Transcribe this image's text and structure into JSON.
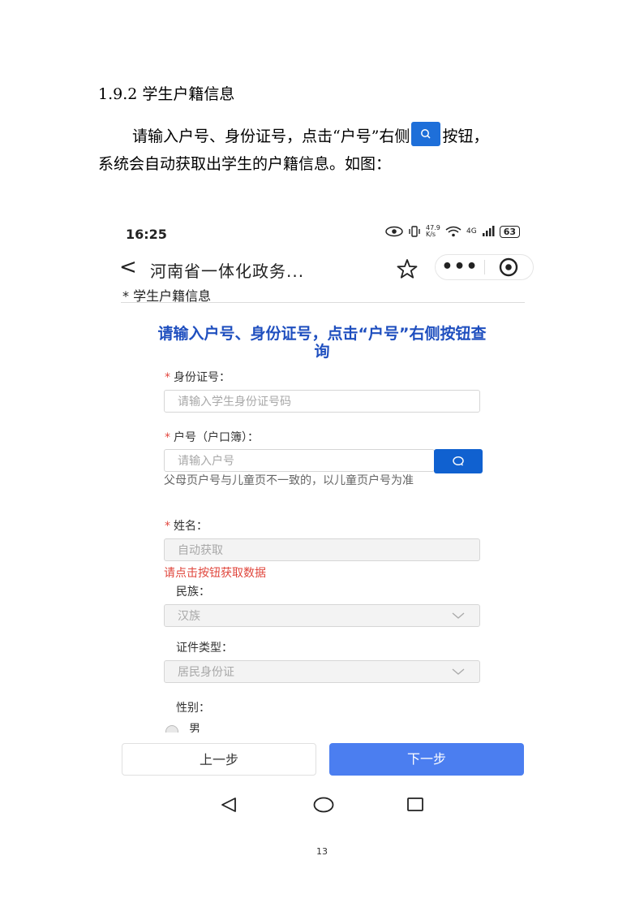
{
  "doc": {
    "heading": "1.9.2 学生户籍信息",
    "para_line1_a": "请输入户号、身份证号，点击“户号”右侧",
    "para_line1_b": "按钮，",
    "para_line2": "系统会自动获取出学生的户籍信息。如图：",
    "page_number": "13"
  },
  "phone": {
    "status": {
      "time": "16:25",
      "network_speed": "47.9 K/s",
      "network_type": "4G",
      "battery": "63"
    },
    "nav": {
      "back": "<",
      "title": "河南省一体化政务...",
      "more": "•••"
    },
    "section_title": "* 学生户籍信息",
    "notice": "请输入户号、身份证号，点击“户号”右侧按钮查询",
    "form": {
      "id_label": "身份证号：",
      "id_placeholder": "请输入学生身份证号码",
      "hukou_label": "户号（户口簿）：",
      "hukou_placeholder": "请输入户号",
      "hukou_hint": "父母页户号与儿童页不一致的，以儿童页户号为准",
      "name_label": "姓名：",
      "name_placeholder": "自动获取",
      "name_error": "请点击按钮获取数据",
      "ethnicity_label": "民族：",
      "ethnicity_value": "汉族",
      "cert_type_label": "证件类型：",
      "cert_type_value": "居民身份证",
      "gender_label": "性别：",
      "gender_option": "男",
      "required_mark": "*"
    },
    "buttons": {
      "prev": "上一步",
      "next": "下一步"
    }
  },
  "colors": {
    "primary": "#1061d0",
    "next_button": "#4b7ef0",
    "notice_text": "#1f4fbf",
    "error": "#e0463c"
  }
}
